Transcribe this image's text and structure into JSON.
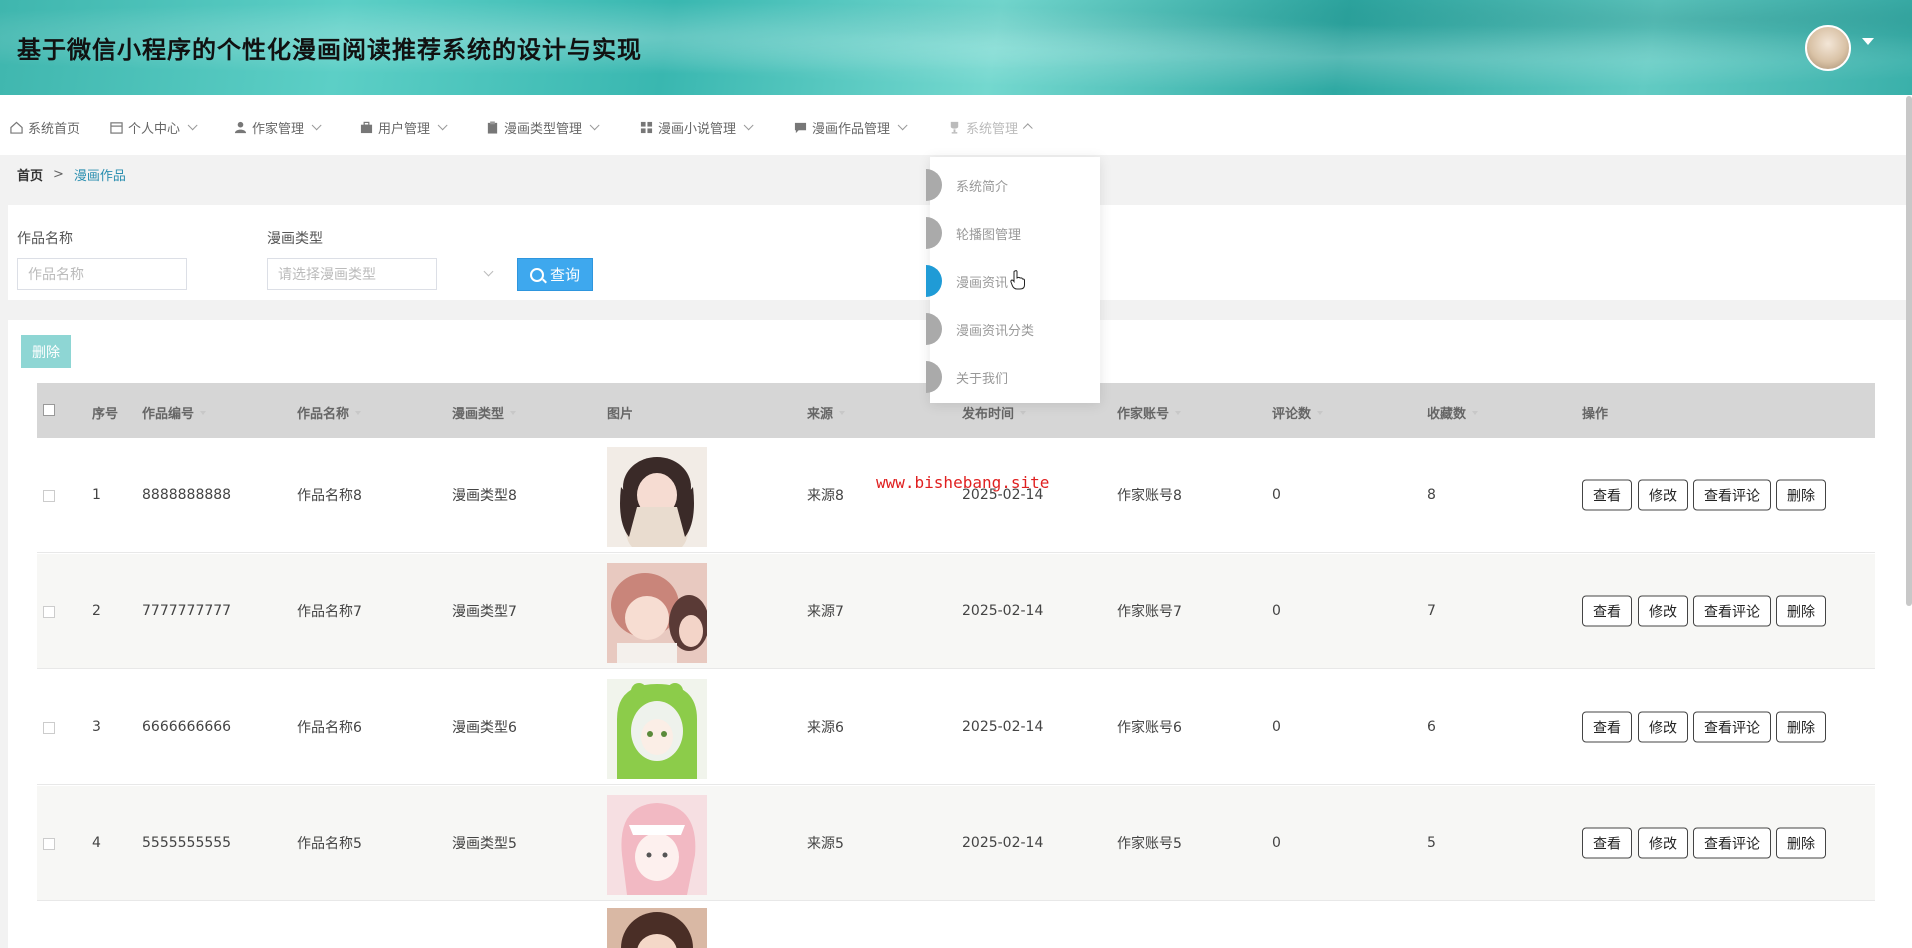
{
  "header": {
    "title": "基于微信小程序的个性化漫画阅读推荐系统的设计与实现"
  },
  "nav": {
    "items": [
      {
        "label": "系统首页",
        "icon": "home-icon"
      },
      {
        "label": "个人中心",
        "icon": "calendar-icon"
      },
      {
        "label": "作家管理",
        "icon": "user-icon"
      },
      {
        "label": "用户管理",
        "icon": "briefcase-icon"
      },
      {
        "label": "漫画类型管理",
        "icon": "clipboard-icon"
      },
      {
        "label": "漫画小说管理",
        "icon": "grid-icon"
      },
      {
        "label": "漫画作品管理",
        "icon": "chat-icon"
      },
      {
        "label": "系统管理",
        "icon": "trophy-icon"
      }
    ]
  },
  "breadcrumb": {
    "home": "首页",
    "sep": ">",
    "current": "漫画作品"
  },
  "search": {
    "name_label": "作品名称",
    "name_placeholder": "作品名称",
    "type_label": "漫画类型",
    "type_placeholder": "请选择漫画类型",
    "query_label": "查询"
  },
  "toolbar": {
    "delete_label": "删除"
  },
  "table": {
    "columns": [
      "序号",
      "作品编号",
      "作品名称",
      "漫画类型",
      "图片",
      "来源",
      "发布时间",
      "作家账号",
      "评论数",
      "收藏数",
      "操作"
    ],
    "actions": [
      "查看",
      "修改",
      "查看评论",
      "删除"
    ],
    "rows": [
      {
        "index": "1",
        "code": "8888888888",
        "name": "作品名称8",
        "type": "漫画类型8",
        "source": "来源8",
        "date": "2025-02-14",
        "author": "作家账号8",
        "comments": "0",
        "favorites": "8"
      },
      {
        "index": "2",
        "code": "7777777777",
        "name": "作品名称7",
        "type": "漫画类型7",
        "source": "来源7",
        "date": "2025-02-14",
        "author": "作家账号7",
        "comments": "0",
        "favorites": "7"
      },
      {
        "index": "3",
        "code": "6666666666",
        "name": "作品名称6",
        "type": "漫画类型6",
        "source": "来源6",
        "date": "2025-02-14",
        "author": "作家账号6",
        "comments": "0",
        "favorites": "6"
      },
      {
        "index": "4",
        "code": "5555555555",
        "name": "作品名称5",
        "type": "漫画类型5",
        "source": "来源5",
        "date": "2025-02-14",
        "author": "作家账号5",
        "comments": "0",
        "favorites": "5"
      }
    ]
  },
  "dropdown": {
    "items": [
      "系统简介",
      "轮播图管理",
      "漫画资讯",
      "漫画资讯分类",
      "关于我们"
    ],
    "active_index": 2
  },
  "watermark": "www.bishebang.site"
}
